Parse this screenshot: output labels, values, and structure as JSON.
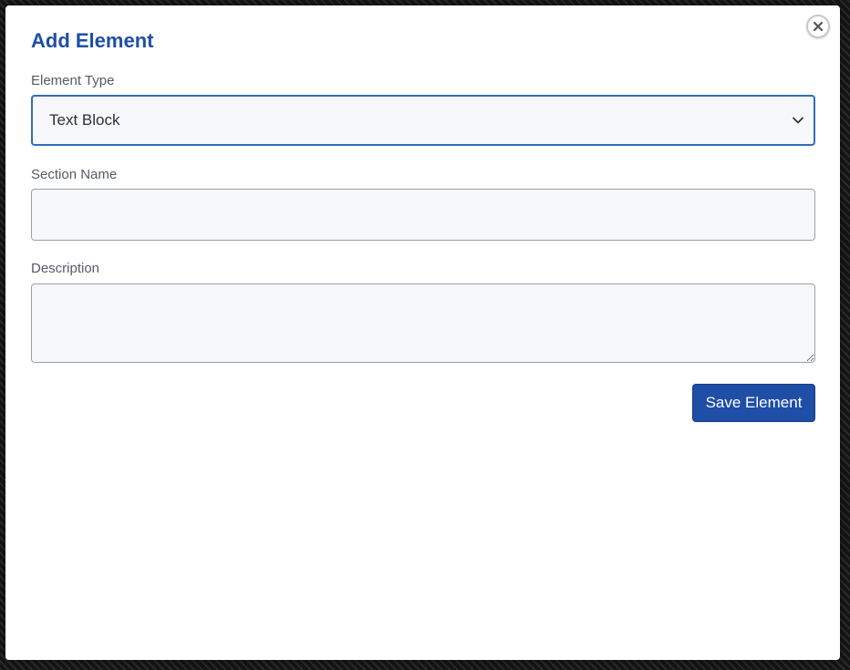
{
  "modal": {
    "title": "Add Element",
    "close_icon": "close-icon"
  },
  "form": {
    "element_type": {
      "label": "Element Type",
      "selected_value": "Text Block",
      "icon": "chevron-down-icon"
    },
    "section_name": {
      "label": "Section Name",
      "value": "",
      "placeholder": ""
    },
    "description": {
      "label": "Description",
      "value": "",
      "placeholder": ""
    },
    "save_label": "Save Element"
  },
  "colors": {
    "accent": "#1f4ea6",
    "focus_border": "#2f6fb8",
    "field_background": "#f7f8fb",
    "label_text": "#555b63"
  }
}
